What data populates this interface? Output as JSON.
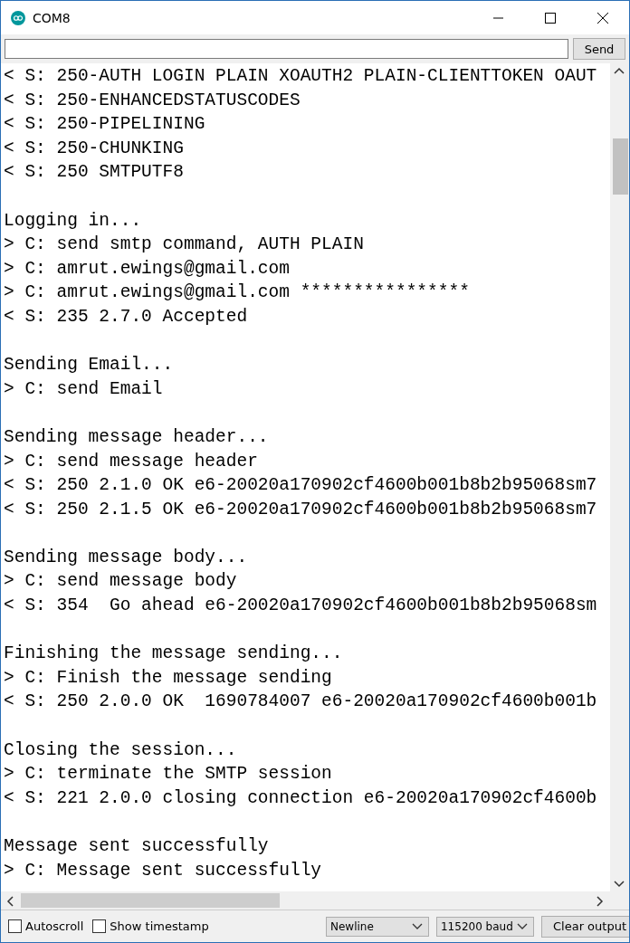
{
  "window": {
    "title": "COM8"
  },
  "input": {
    "button": "Send"
  },
  "log": [
    {
      "kind": "text",
      "text": "< S: 250-AUTH LOGIN PLAIN XOAUTH2 PLAIN-CLIENTTOKEN OAUT"
    },
    {
      "kind": "text",
      "text": "< S: 250-ENHANCEDSTATUSCODES"
    },
    {
      "kind": "text",
      "text": "< S: 250-PIPELINING"
    },
    {
      "kind": "text",
      "text": "< S: 250-CHUNKING"
    },
    {
      "kind": "text",
      "text": "< S: 250 SMTPUTF8"
    },
    {
      "kind": "blank"
    },
    {
      "kind": "text",
      "text": "Logging in..."
    },
    {
      "kind": "text",
      "text": "> C: send smtp command, AUTH PLAIN"
    },
    {
      "kind": "text",
      "text": "> C: amrut.ewings@gmail.com"
    },
    {
      "kind": "text",
      "text": "> C: amrut.ewings@gmail.com ****************"
    },
    {
      "kind": "text",
      "text": "< S: 235 2.7.0 Accepted"
    },
    {
      "kind": "blank"
    },
    {
      "kind": "text",
      "text": "Sending Email..."
    },
    {
      "kind": "text",
      "text": "> C: send Email"
    },
    {
      "kind": "blank"
    },
    {
      "kind": "text",
      "text": "Sending message header..."
    },
    {
      "kind": "text",
      "text": "> C: send message header"
    },
    {
      "kind": "text",
      "text": "< S: 250 2.1.0 OK e6-20020a170902cf4600b001b8b2b95068sm7"
    },
    {
      "kind": "text",
      "text": "< S: 250 2.1.5 OK e6-20020a170902cf4600b001b8b2b95068sm7"
    },
    {
      "kind": "blank"
    },
    {
      "kind": "text",
      "text": "Sending message body..."
    },
    {
      "kind": "text",
      "text": "> C: send message body"
    },
    {
      "kind": "text",
      "text": "< S: 354  Go ahead e6-20020a170902cf4600b001b8b2b95068sm"
    },
    {
      "kind": "blank"
    },
    {
      "kind": "text",
      "text": "Finishing the message sending..."
    },
    {
      "kind": "text",
      "text": "> C: Finish the message sending"
    },
    {
      "kind": "text",
      "text": "< S: 250 2.0.0 OK  1690784007 e6-20020a170902cf4600b001b"
    },
    {
      "kind": "blank"
    },
    {
      "kind": "text",
      "text": "Closing the session..."
    },
    {
      "kind": "text",
      "text": "> C: terminate the SMTP session"
    },
    {
      "kind": "text",
      "text": "< S: 221 2.0.0 closing connection e6-20020a170902cf4600b"
    },
    {
      "kind": "blank"
    },
    {
      "kind": "text",
      "text": "Message sent successfully"
    },
    {
      "kind": "text",
      "text": "> C: Message sent successfully"
    }
  ],
  "footer": {
    "checkboxes": [
      {
        "label": "Autoscroll",
        "checked": false
      },
      {
        "label": "Show timestamp",
        "checked": false
      }
    ],
    "line_ending": "Newline",
    "baud": "115200 baud",
    "clear": "Clear output"
  }
}
